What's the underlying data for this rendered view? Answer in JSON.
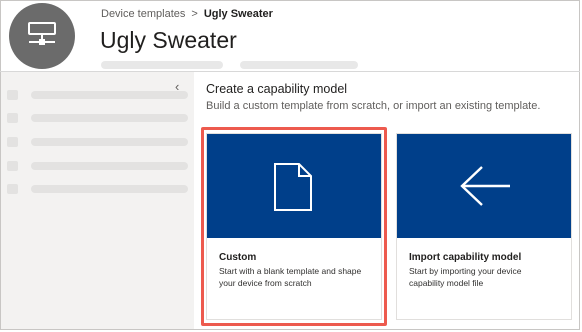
{
  "breadcrumb": {
    "parent": "Device templates",
    "separator": ">",
    "current": "Ugly Sweater"
  },
  "header": {
    "title": "Ugly Sweater",
    "avatar_icon": "device-icon"
  },
  "sidebar": {
    "collapse_icon": "chevron-left-icon",
    "collapse_glyph": "‹"
  },
  "main": {
    "section_title": "Create a capability model",
    "section_desc": "Build a custom template from scratch, or import an existing template.",
    "cards": [
      {
        "title": "Custom",
        "description": "Start with a blank template and shape your device from scratch",
        "icon": "blank-document-icon",
        "selected": true
      },
      {
        "title": "Import capability model",
        "description": "Start by importing your device capability model file",
        "icon": "arrow-left-icon",
        "selected": false
      }
    ]
  },
  "colors": {
    "card_banner": "#003f8a",
    "highlight": "#ed5a4e",
    "avatar": "#6b6b6b",
    "sidebar": "#f3f2f1"
  }
}
